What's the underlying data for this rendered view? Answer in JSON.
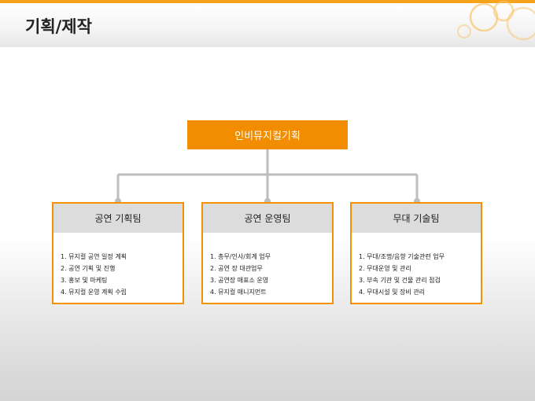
{
  "title": "기획/제작",
  "root": {
    "label": "인비뮤지컬기획"
  },
  "teams": [
    {
      "name": "공연 기획팀",
      "items": [
        "1. 뮤지컬 공연 일정 계획",
        "2. 공연 기획 및 진행",
        "3. 홍보 및 마케팅",
        "4. 뮤지컬 운영 계획 수립"
      ]
    },
    {
      "name": "공연 운영팀",
      "items": [
        "1. 총무/인사/회계 업무",
        "2. 공연 장 대관업무",
        "3. 공연장 매표소 운영",
        "4. 뮤지컬 매니지먼트"
      ]
    },
    {
      "name": "무대 기술팀",
      "items": [
        "1. 무대/조명/음향 기술관련 업무",
        "2. 무대운영 및 관리",
        "3. 부속 기관 및 건물 관리 점검",
        "4. 무대시설 및 장비 관리"
      ]
    }
  ],
  "colors": {
    "accent": "#f28c00",
    "border": "#f39200",
    "header_gray": "#dcdcdc",
    "connector": "#bdbdbd"
  }
}
